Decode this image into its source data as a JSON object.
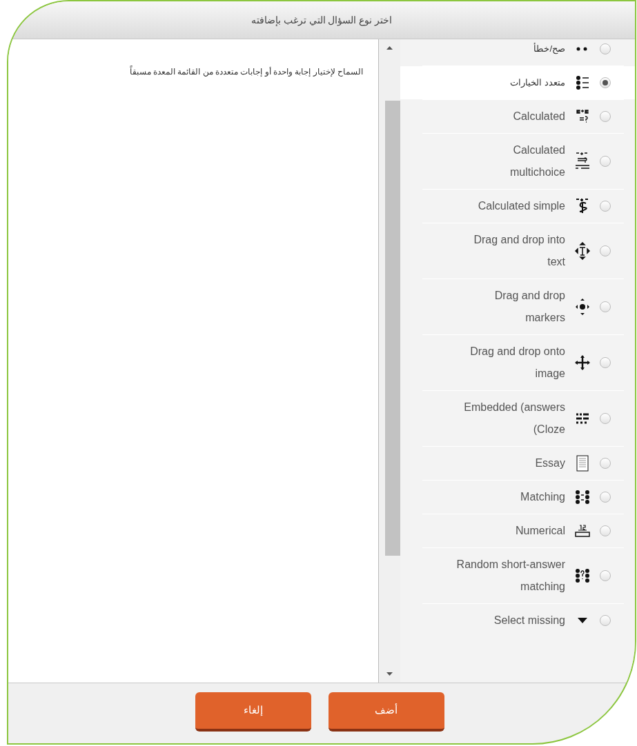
{
  "dialog": {
    "title": "اختر نوع السؤال التي ترغب بإضافته",
    "description": "السماح لإختيار إجابة واحدة أو إجابات متعددة من القائمة المعدة مسبقاً",
    "question_types": [
      {
        "label": "صح/خطأ",
        "selected": false
      },
      {
        "label": "متعدد الخيارات",
        "selected": true
      },
      {
        "label": "Calculated",
        "selected": false
      },
      {
        "label": "Calculated multichoice",
        "selected": false
      },
      {
        "label": "Calculated simple",
        "selected": false
      },
      {
        "label": "Drag and drop into text",
        "selected": false
      },
      {
        "label": "Drag and drop markers",
        "selected": false
      },
      {
        "label": "Drag and drop onto image",
        "selected": false
      },
      {
        "label": "Embedded (answers (Cloze",
        "selected": false
      },
      {
        "label": "Essay",
        "selected": false
      },
      {
        "label": "Matching",
        "selected": false
      },
      {
        "label": "Numerical",
        "selected": false
      },
      {
        "label": "Random short-answer matching",
        "selected": false
      },
      {
        "label": "Select missing",
        "selected": false
      }
    ],
    "buttons": [
      {
        "label": "أضف"
      },
      {
        "label": "إلغاء"
      }
    ]
  }
}
